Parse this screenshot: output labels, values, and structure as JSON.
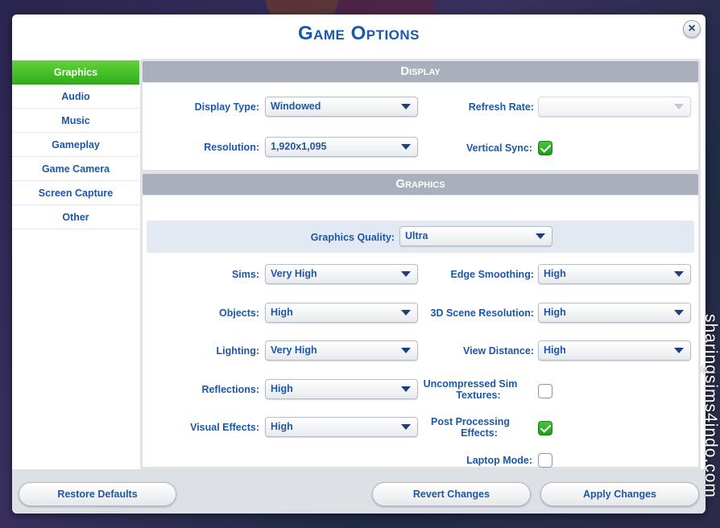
{
  "dialog": {
    "title": "Game Options",
    "close_glyph": "×"
  },
  "sidebar": {
    "items": [
      {
        "label": "Graphics",
        "active": true
      },
      {
        "label": "Audio"
      },
      {
        "label": "Music"
      },
      {
        "label": "Gameplay"
      },
      {
        "label": "Game Camera"
      },
      {
        "label": "Screen Capture"
      },
      {
        "label": "Other"
      }
    ]
  },
  "display": {
    "header": "Display",
    "display_type": {
      "label": "Display Type:",
      "value": "Windowed"
    },
    "refresh_rate": {
      "label": "Refresh Rate:",
      "value": ""
    },
    "resolution": {
      "label": "Resolution:",
      "value": "1,920x1,095"
    },
    "vertical_sync": {
      "label": "Vertical Sync:",
      "checked": true
    }
  },
  "graphics": {
    "header": "Graphics",
    "quality": {
      "label": "Graphics Quality:",
      "value": "Ultra"
    },
    "sims": {
      "label": "Sims:",
      "value": "Very High"
    },
    "objects": {
      "label": "Objects:",
      "value": "High"
    },
    "lighting": {
      "label": "Lighting:",
      "value": "Very High"
    },
    "reflections": {
      "label": "Reflections:",
      "value": "High"
    },
    "visual_effects": {
      "label": "Visual Effects:",
      "value": "High"
    },
    "edge_smoothing": {
      "label": "Edge Smoothing:",
      "value": "High"
    },
    "scene_resolution": {
      "label": "3D Scene Resolution:",
      "value": "High"
    },
    "view_distance": {
      "label": "View Distance:",
      "value": "High"
    },
    "uncompressed_textures": {
      "label_line1": "Uncompressed Sim",
      "label_line2": "Textures:",
      "checked": false
    },
    "post_processing": {
      "label_line1": "Post Processing",
      "label_line2": "Effects:",
      "checked": true
    },
    "laptop_mode": {
      "label": "Laptop Mode:",
      "checked": false
    }
  },
  "footer": {
    "restore_defaults": "Restore Defaults",
    "revert_changes": "Revert Changes",
    "apply_changes": "Apply Changes"
  },
  "watermark": "sharingsims4indo.com",
  "colors": {
    "accent": "#1d57a8",
    "active_tab": "#3cba24",
    "header_bar": "#a9b0bb",
    "check_green": "#2fae1a"
  }
}
